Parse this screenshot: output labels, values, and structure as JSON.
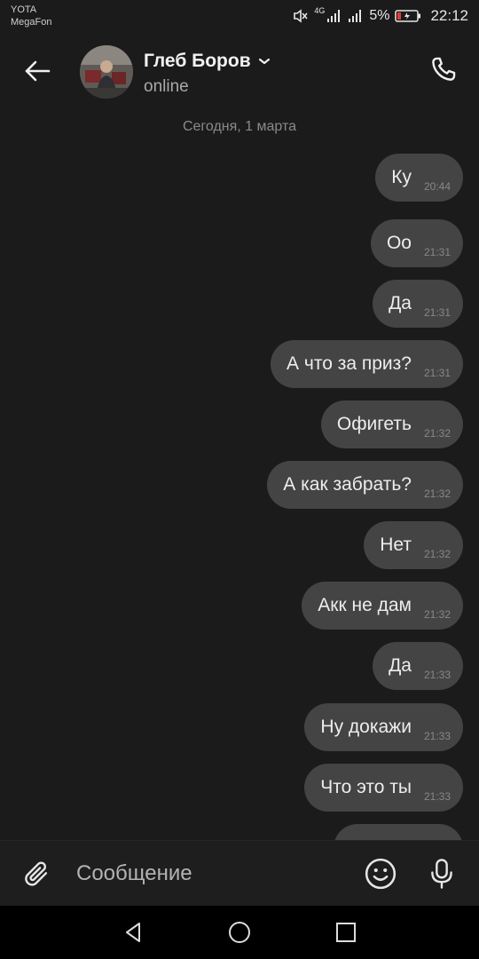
{
  "status_bar": {
    "carrier_1": "YOTA",
    "carrier_2": "MegaFon",
    "network": "4G",
    "battery": "5%",
    "time": "22:12"
  },
  "header": {
    "back_icon": "arrow-left-icon",
    "contact_name": "Глеб Боров",
    "contact_status": "online",
    "call_icon": "phone-icon"
  },
  "chat": {
    "date_separator": "Сегодня, 1 марта",
    "messages": [
      {
        "text": "Ку",
        "time": "20:44"
      },
      {
        "text": "Оо",
        "time": "21:31"
      },
      {
        "text": "Да",
        "time": "21:31"
      },
      {
        "text": "А что за приз?",
        "time": "21:31"
      },
      {
        "text": "Офигеть",
        "time": "21:32"
      },
      {
        "text": "А как забрать?",
        "time": "21:32"
      },
      {
        "text": "Нет",
        "time": "21:32"
      },
      {
        "text": "Акк не дам",
        "time": "21:32"
      },
      {
        "text": "Да",
        "time": "21:33"
      },
      {
        "text": "Ну докажи",
        "time": "21:33"
      },
      {
        "text": "Что это ты",
        "time": "21:33"
      }
    ]
  },
  "composer": {
    "placeholder": "Сообщение",
    "attach_icon": "paperclip-icon",
    "emoji_icon": "smiley-icon",
    "mic_icon": "microphone-icon"
  },
  "colors": {
    "background": "#1b1b1b",
    "bubble": "#444444",
    "text": "#ededed",
    "muted": "#8a8a8a"
  }
}
